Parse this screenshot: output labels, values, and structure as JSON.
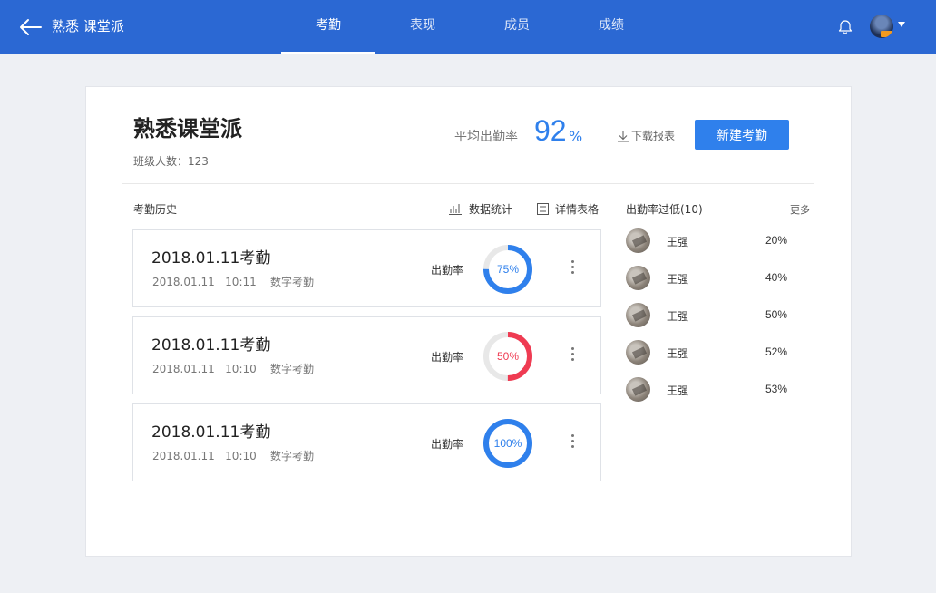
{
  "header": {
    "title": "熟悉 课堂派",
    "tabs": [
      {
        "label": "考勤",
        "active": true
      },
      {
        "label": "表现",
        "active": false
      },
      {
        "label": "成员",
        "active": false
      },
      {
        "label": "成绩",
        "active": false
      }
    ],
    "icons": [
      "back-arrow-icon",
      "bell-icon",
      "avatar",
      "caret-down-icon"
    ]
  },
  "summary": {
    "class_name": "熟悉课堂派",
    "member_count_text": "班级人数：123",
    "avg_label": "平均出勤率",
    "avg_value": "92",
    "avg_unit": "%",
    "download_label": "下载报表",
    "new_button_label": "新建考勤"
  },
  "history": {
    "label": "考勤历史",
    "stats_link": "数据统计",
    "table_link": "详情表格",
    "records": [
      {
        "title": "2018.01.11考勤",
        "date": "2018.01.11",
        "time": "10:11",
        "type": "数字考勤",
        "rate_label": "出勤率",
        "rate": 75,
        "rate_text": "75%",
        "color": "#2f80ec"
      },
      {
        "title": "2018.01.11考勤",
        "date": "2018.01.11",
        "time": "10:10",
        "type": "数字考勤",
        "rate_label": "出勤率",
        "rate": 50,
        "rate_text": "50%",
        "color": "#ef3b52"
      },
      {
        "title": "2018.01.11考勤",
        "date": "2018.01.11",
        "time": "10:10",
        "type": "数字考勤",
        "rate_label": "出勤率",
        "rate": 100,
        "rate_text": "100%",
        "color": "#2f80ec"
      }
    ]
  },
  "low_attendance": {
    "label": "出勤率过低(10)",
    "more_label": "更多",
    "students": [
      {
        "name": "王强",
        "rate": "20%"
      },
      {
        "name": "王强",
        "rate": "40%"
      },
      {
        "name": "王强",
        "rate": "50%"
      },
      {
        "name": "王强",
        "rate": "52%"
      },
      {
        "name": "王强",
        "rate": "53%"
      }
    ]
  },
  "colors": {
    "header_bg": "#2b68d3",
    "accent": "#2f80ec",
    "warning": "#ef3b52",
    "page_bg": "#eef0f4"
  }
}
